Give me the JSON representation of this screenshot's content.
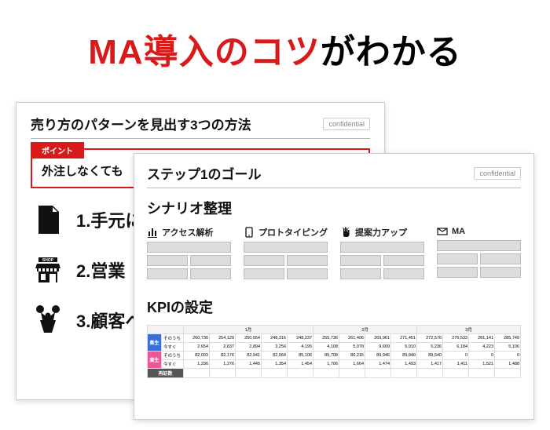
{
  "headline": {
    "part1": "MA導入",
    "part2": "のコツ",
    "part3": "がわかる"
  },
  "confidential": "confidential",
  "slideA": {
    "title": "売り方のパターンを見出す3つの方法",
    "pointTag": "ポイント",
    "pointText": "外注しなくても",
    "items": [
      "1.手元に",
      "2.営業",
      "3.顧客へ"
    ]
  },
  "slideB": {
    "title": "ステップ1のゴール",
    "section1": "シナリオ整理",
    "categories": [
      "アクセス解析",
      "プロトタイピング",
      "提案力アップ",
      "MA"
    ],
    "section2": "KPIの設定",
    "kpi": {
      "months": [
        "1月",
        "2月",
        "3月"
      ],
      "subcols": [
        "",
        "",
        "",
        "",
        "",
        "",
        "",
        "",
        "",
        "",
        "",
        "",
        "",
        "",
        ""
      ],
      "groups": [
        {
          "label": "集生",
          "color": "g-blue",
          "rows": [
            {
              "label": "そのうち",
              "values": [
                "260,730",
                "254,129",
                "250,654",
                "248,316",
                "248,237",
                "255,736",
                "261,406",
                "269,961",
                "271,451",
                "272,576",
                "276,533",
                "281,141",
                "285,749"
              ]
            },
            {
              "label": "今すぐ",
              "values": [
                "2,654",
                "2,837",
                "2,894",
                "3,256",
                "4,195",
                "4,108",
                "5,078",
                "9,609",
                "5,910",
                "5,236",
                "6,184",
                "4,223",
                "5,106"
              ]
            }
          ]
        },
        {
          "label": "案生",
          "color": "g-pink",
          "rows": [
            {
              "label": "そのうち",
              "values": [
                "82,003",
                "82,176",
                "82,941",
                "82,064",
                "85,106",
                "85,708",
                "86,215",
                "89,946",
                "89,840",
                "89,640",
                "0",
                "0",
                "0"
              ]
            },
            {
              "label": "今すぐ",
              "values": [
                "1,236",
                "1,276",
                "1,445",
                "1,354",
                "1,454",
                "1,706",
                "1,664",
                "1,474",
                "1,493",
                "1,417",
                "1,411",
                "1,521",
                "1,488"
              ]
            }
          ]
        },
        {
          "label": "再訪数",
          "color": "g-dark",
          "rows": []
        }
      ]
    }
  }
}
